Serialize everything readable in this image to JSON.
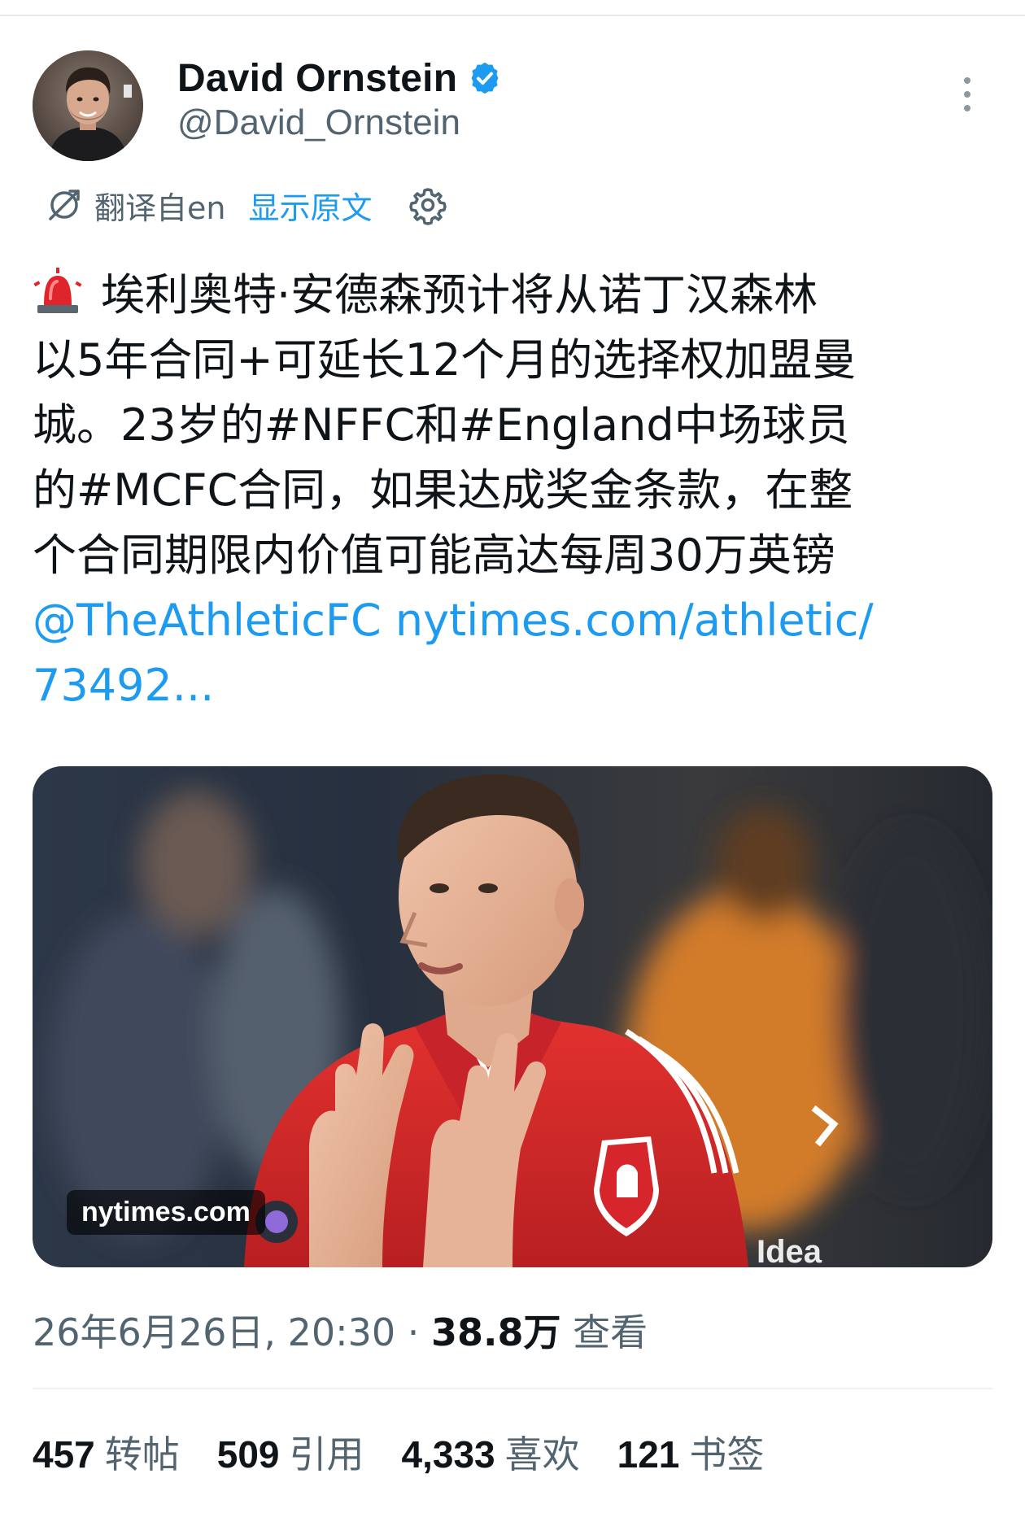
{
  "author": {
    "display_name": "David Ornstein",
    "handle": "@David_Ornstein",
    "verified": true
  },
  "translation": {
    "label": "翻译自en",
    "show_original": "显示原文"
  },
  "tweet": {
    "line1": "埃利奥特·安德森预计将从诺丁汉森林",
    "line2": "以5年合同+可延长12个月的选择权加盟曼",
    "line3": "城。23岁的#NFFC和#England中场球员",
    "line4": "的#MCFC合同，如果达成奖金条款，在整",
    "line5": "个合同期限内价值可能高达每周30万英镑",
    "mention": "@TheAthleticFC",
    "link_part1": "nytimes.com/athletic/",
    "link_part2": "73492..."
  },
  "media": {
    "domain": "nytimes.com"
  },
  "meta": {
    "datetime": "26年6月26日, 20:30",
    "separator": " · ",
    "views": "38.8万",
    "views_label": "查看"
  },
  "stats": {
    "reposts": {
      "count": "457",
      "label": "转帖"
    },
    "quotes": {
      "count": "509",
      "label": "引用"
    },
    "likes": {
      "count": "4,333",
      "label": "喜欢"
    },
    "bookmarks": {
      "count": "121",
      "label": "书签"
    }
  },
  "colors": {
    "accent": "#1d9bf0",
    "secondary_text": "#536471",
    "primary_text": "#0f1419",
    "jersey_red": "#d7262b"
  },
  "icons": {
    "verified": "verified-badge-icon",
    "more": "more-vertical-icon",
    "translate": "translate-icon",
    "settings": "gear-icon",
    "emoji": "police-siren-icon"
  }
}
